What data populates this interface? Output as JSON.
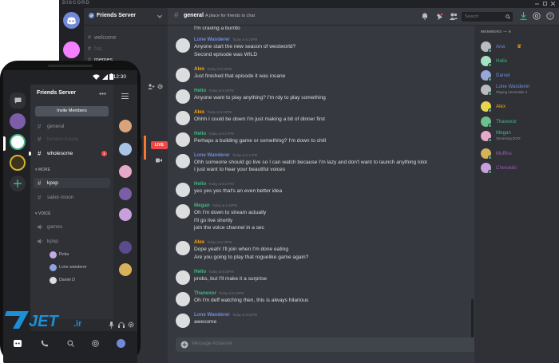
{
  "desktop": {
    "titlebar": "DISCORD",
    "server_name": "Friends Server",
    "channels": [
      {
        "name": "welcome"
      },
      {
        "name": "faq"
      },
      {
        "name": "memes"
      }
    ],
    "header": {
      "channel": "general",
      "topic": "A place for friends to chat"
    },
    "search_placeholder": "Search",
    "composer_placeholder": "Message #channel",
    "live_label": "LIVE",
    "members_heading": "MEMBERS — 9",
    "messages": [
      {
        "user": "",
        "time": "",
        "color": "#dcddde",
        "lines": [
          "I'm craving a burrito"
        ]
      },
      {
        "user": "Lone Wanderer",
        "time": "Today at 6:15PM",
        "color": "#7289da",
        "lines": [
          "Anyone start the new season of westworld?",
          "Second episode was WILD"
        ]
      },
      {
        "user": "Alex",
        "time": "Today at 6:16PM",
        "color": "#faa61a",
        "lines": [
          "Just finished that episode it was insane"
        ]
      },
      {
        "user": "Helio",
        "time": "Today at 6:16PM",
        "color": "#43b581",
        "lines": [
          "Anyone want to play anything? I'm rdy to play something"
        ]
      },
      {
        "user": "Alex",
        "time": "Today at 6:16PM",
        "color": "#faa61a",
        "lines": [
          "Ohhh I could be down I'm just making a bit of dinner first"
        ]
      },
      {
        "user": "Helio",
        "time": "Today at 6:17PM",
        "color": "#43b581",
        "lines": [
          "Perhaps a building game or something? I'm down to chill"
        ]
      },
      {
        "user": "Lone Wanderer",
        "time": "Today at 6:17PM",
        "color": "#7289da",
        "lines": [
          "Ohh someone should go live so I can watch because I'm lazy and don't want to launch anything lolol",
          "I just want to hear your beautiful voices"
        ]
      },
      {
        "user": "Helio",
        "time": "Today at 6:17PM",
        "color": "#43b581",
        "lines": [
          "yes yes yes that's an even better idea"
        ]
      },
      {
        "user": "Megan",
        "time": "Today at 6:18PM",
        "color": "#43b581",
        "lines": [
          "Oh I'm down to stream actually",
          "I'll go live shortly",
          "join the voice channel in a sec"
        ]
      },
      {
        "user": "Alex",
        "time": "Today at 6:19PM",
        "color": "#faa61a",
        "lines": [
          "Dope yeah! I'll join when I'm done eating",
          "Are you going to play that roguelike game again?"
        ]
      },
      {
        "user": "Helio",
        "time": "Today at 6:19PM",
        "color": "#43b581",
        "lines": [
          "probs, but I'll make it a surprise"
        ]
      },
      {
        "user": "Thanexor",
        "time": "Today at 6:19PM",
        "color": "#43b581",
        "lines": [
          "Oh I'm deff watching then, this is always hilarious"
        ]
      },
      {
        "user": "Lone Wanderer",
        "time": "Today at 6:20PM",
        "color": "#7289da",
        "lines": [
          "awesome"
        ]
      }
    ],
    "members": [
      {
        "name": "Ana",
        "sub": "",
        "color": "#7289da",
        "avatar": "#b9bbbe"
      },
      {
        "name": "Helio",
        "sub": "",
        "color": "#43b581",
        "avatar": "#a5e1c4"
      },
      {
        "name": "Daniel",
        "sub": "",
        "color": "#7289da",
        "avatar": "#96a7d8"
      },
      {
        "name": "Lone Wanderer",
        "sub": "Playing Vermintide 2",
        "color": "#7289da",
        "avatar": "#b9bbbe"
      },
      {
        "name": "Alex",
        "sub": "",
        "color": "#faa61a",
        "avatar": "#e8d44d"
      },
      {
        "name": "Thanexor",
        "sub": "",
        "color": "#43b581",
        "avatar": "#6dbf8b"
      },
      {
        "name": "Megan",
        "sub": "Streaming ZOIX",
        "color": "#43b581",
        "avatar": "#e6a9c9"
      },
      {
        "name": "Muffins",
        "sub": "",
        "color": "#9b59b6",
        "avatar": "#d8b25a"
      },
      {
        "name": "Cherukiki",
        "sub": "",
        "color": "#9b59b6",
        "avatar": "#c9a0dc"
      }
    ]
  },
  "phone": {
    "clock": "12:30",
    "server_name": "Friends Server",
    "invite_label": "Invite Members",
    "text_channels": [
      {
        "name": "general",
        "badge": ""
      },
      {
        "name": "terrace-house",
        "badge": ""
      },
      {
        "name": "wholesome",
        "badge": "1"
      }
    ],
    "more_label": "MORE",
    "more_channels": [
      {
        "name": "kpop"
      },
      {
        "name": "sailor-moon"
      }
    ],
    "voice_label": "VOICE",
    "voice_channels": [
      {
        "name": "games"
      },
      {
        "name": "kpop"
      }
    ],
    "voice_users": [
      "Roka",
      "Lone wanderer",
      "Daniel D"
    ]
  },
  "watermark": {
    "text": "7JET.ir"
  },
  "colors": {
    "bg": "#36393f",
    "sidebar": "#2f3136",
    "dark": "#202225",
    "blurple": "#7289da",
    "green": "#43b581",
    "red": "#f04747"
  }
}
